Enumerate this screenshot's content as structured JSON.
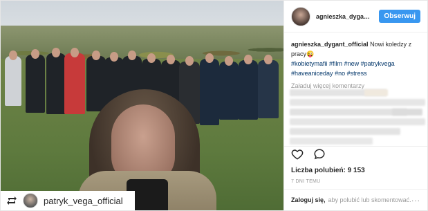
{
  "author": {
    "username": "agnieszka_dygant_off",
    "follow_label": "Obserwuj"
  },
  "caption": {
    "username": "agnieszka_dygant_official",
    "text_line": "Nowi koledzy z pracy",
    "emoji": "😜",
    "hashtags": [
      "#kobietymafii",
      "#film",
      "#new",
      "#patrykvega",
      "#haveaniceday",
      "#no",
      "#stress"
    ]
  },
  "comments": {
    "load_more": "Załaduj więcej komentarzy"
  },
  "stats": {
    "likes_label": "Liczba polubień:",
    "likes_value": "9 153",
    "time_ago": "7 DNI TEMU"
  },
  "login": {
    "link": "Zaloguj się,",
    "rest": "aby polubić lub skomentować.",
    "more": "..."
  },
  "repost": {
    "username": "patryk_vega_official"
  },
  "icons": {
    "heart": "heart-icon",
    "comment": "comment-icon",
    "repost": "repost-icon"
  },
  "colors": {
    "follow_button": "#3897f0",
    "hashtag": "#003569",
    "meta_gray": "#999999"
  }
}
